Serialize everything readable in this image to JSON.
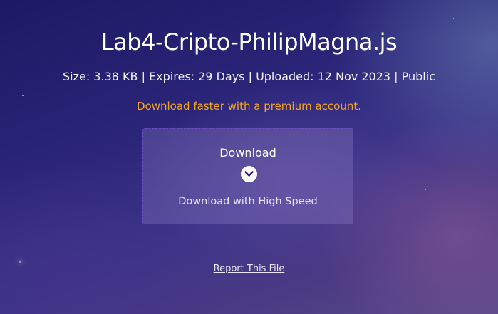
{
  "file": {
    "name": "Lab4-Cripto-PhilipMagna.js",
    "meta": "Size: 3.38 KB | Expires: 29 Days | Uploaded: 12 Nov 2023 | Public"
  },
  "promo": {
    "premium_text": "Download faster with a premium account."
  },
  "download": {
    "label": "Download",
    "icon": "chevron-down-circle-icon",
    "subtitle": "Download with High Speed"
  },
  "footer": {
    "report_label": "Report This File"
  },
  "colors": {
    "accent_orange": "#f5a623",
    "box_border": "#6e50c8",
    "background_dark": "#1c1a63"
  }
}
